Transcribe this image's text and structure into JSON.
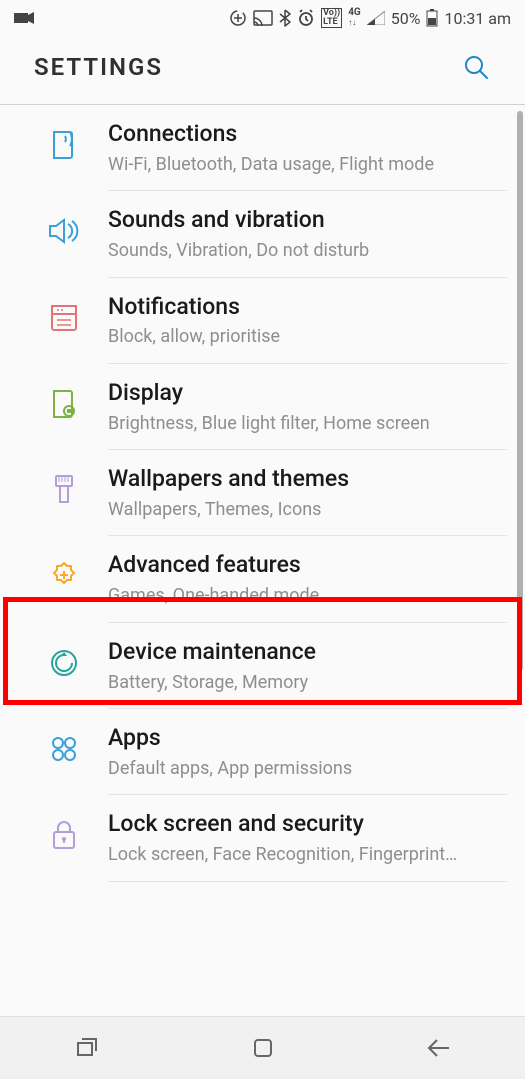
{
  "status": {
    "battery": "50%",
    "time": "10:31 am"
  },
  "header": {
    "title": "SETTINGS"
  },
  "items": [
    {
      "title": "Connections",
      "sub": "Wi-Fi, Bluetooth, Data usage, Flight mode"
    },
    {
      "title": "Sounds and vibration",
      "sub": "Sounds, Vibration, Do not disturb"
    },
    {
      "title": "Notifications",
      "sub": "Block, allow, prioritise"
    },
    {
      "title": "Display",
      "sub": "Brightness, Blue light filter, Home screen"
    },
    {
      "title": "Wallpapers and themes",
      "sub": "Wallpapers, Themes, Icons"
    },
    {
      "title": "Advanced features",
      "sub": "Games, One-handed mode"
    },
    {
      "title": "Device maintenance",
      "sub": "Battery, Storage, Memory"
    },
    {
      "title": "Apps",
      "sub": "Default apps, App permissions"
    },
    {
      "title": "Lock screen and security",
      "sub": "Lock screen, Face Recognition, Fingerprint…"
    }
  ],
  "highlighted_index": 4
}
